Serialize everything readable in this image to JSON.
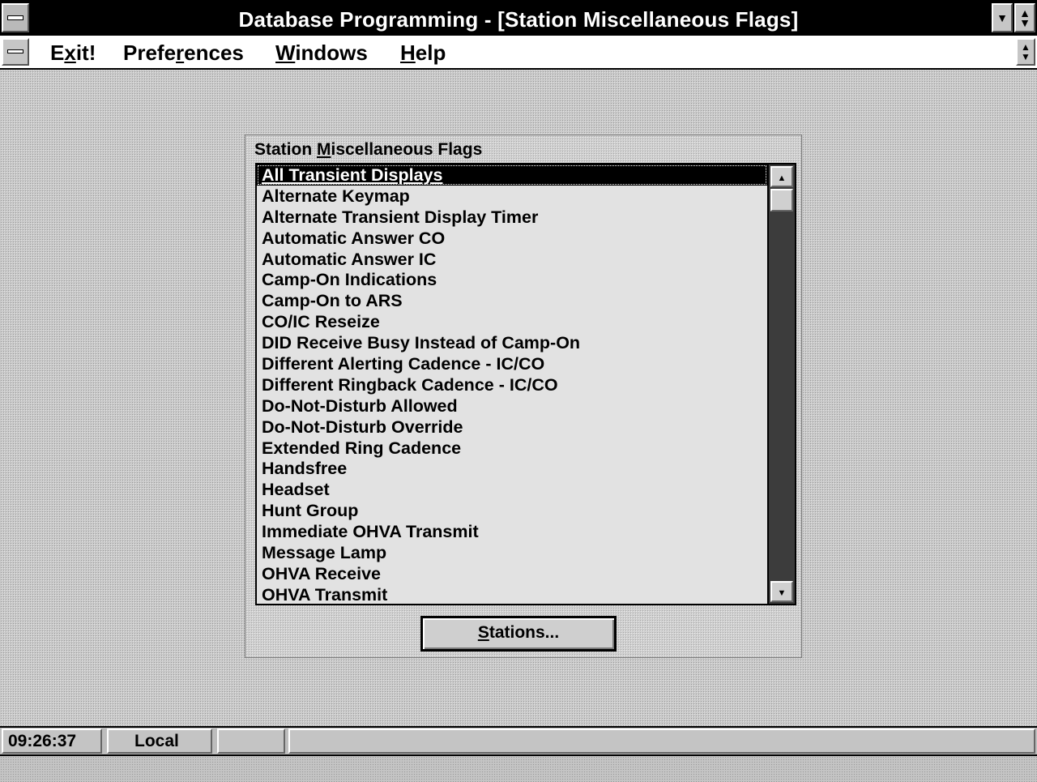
{
  "window": {
    "title": "Database Programming - [Station Miscellaneous Flags]"
  },
  "menu": {
    "items": [
      {
        "pre": "E",
        "key": "x",
        "post": "it!"
      },
      {
        "pre": "Prefe",
        "key": "r",
        "post": "ences"
      },
      {
        "pre": "",
        "key": "W",
        "post": "indows"
      },
      {
        "pre": "",
        "key": "H",
        "post": "elp"
      }
    ]
  },
  "panel": {
    "label_pre": "Station ",
    "label_key": "M",
    "label_post": "iscellaneous Flags",
    "selected_index": 0,
    "items": [
      "All Transient Displays",
      "Alternate Keymap",
      "Alternate Transient Display Timer",
      "Automatic Answer CO",
      "Automatic Answer IC",
      "Camp-On Indications",
      "Camp-On to ARS",
      "CO/IC Reseize",
      "DID Receive Busy Instead of Camp-On",
      "Different Alerting Cadence - IC/CO",
      "Different Ringback Cadence - IC/CO",
      "Do-Not-Disturb Allowed",
      "Do-Not-Disturb Override",
      "Extended Ring Cadence",
      "Handsfree",
      "Headset",
      "Hunt Group",
      "Immediate OHVA Transmit",
      "Message Lamp",
      "OHVA Receive",
      "OHVA Transmit"
    ],
    "stations_button": {
      "key": "S",
      "rest": "tations..."
    }
  },
  "status": {
    "time": "09:26:37",
    "mode": "Local",
    "field3": ""
  },
  "icons": {
    "scroll_up": "▲",
    "scroll_down": "▼"
  }
}
